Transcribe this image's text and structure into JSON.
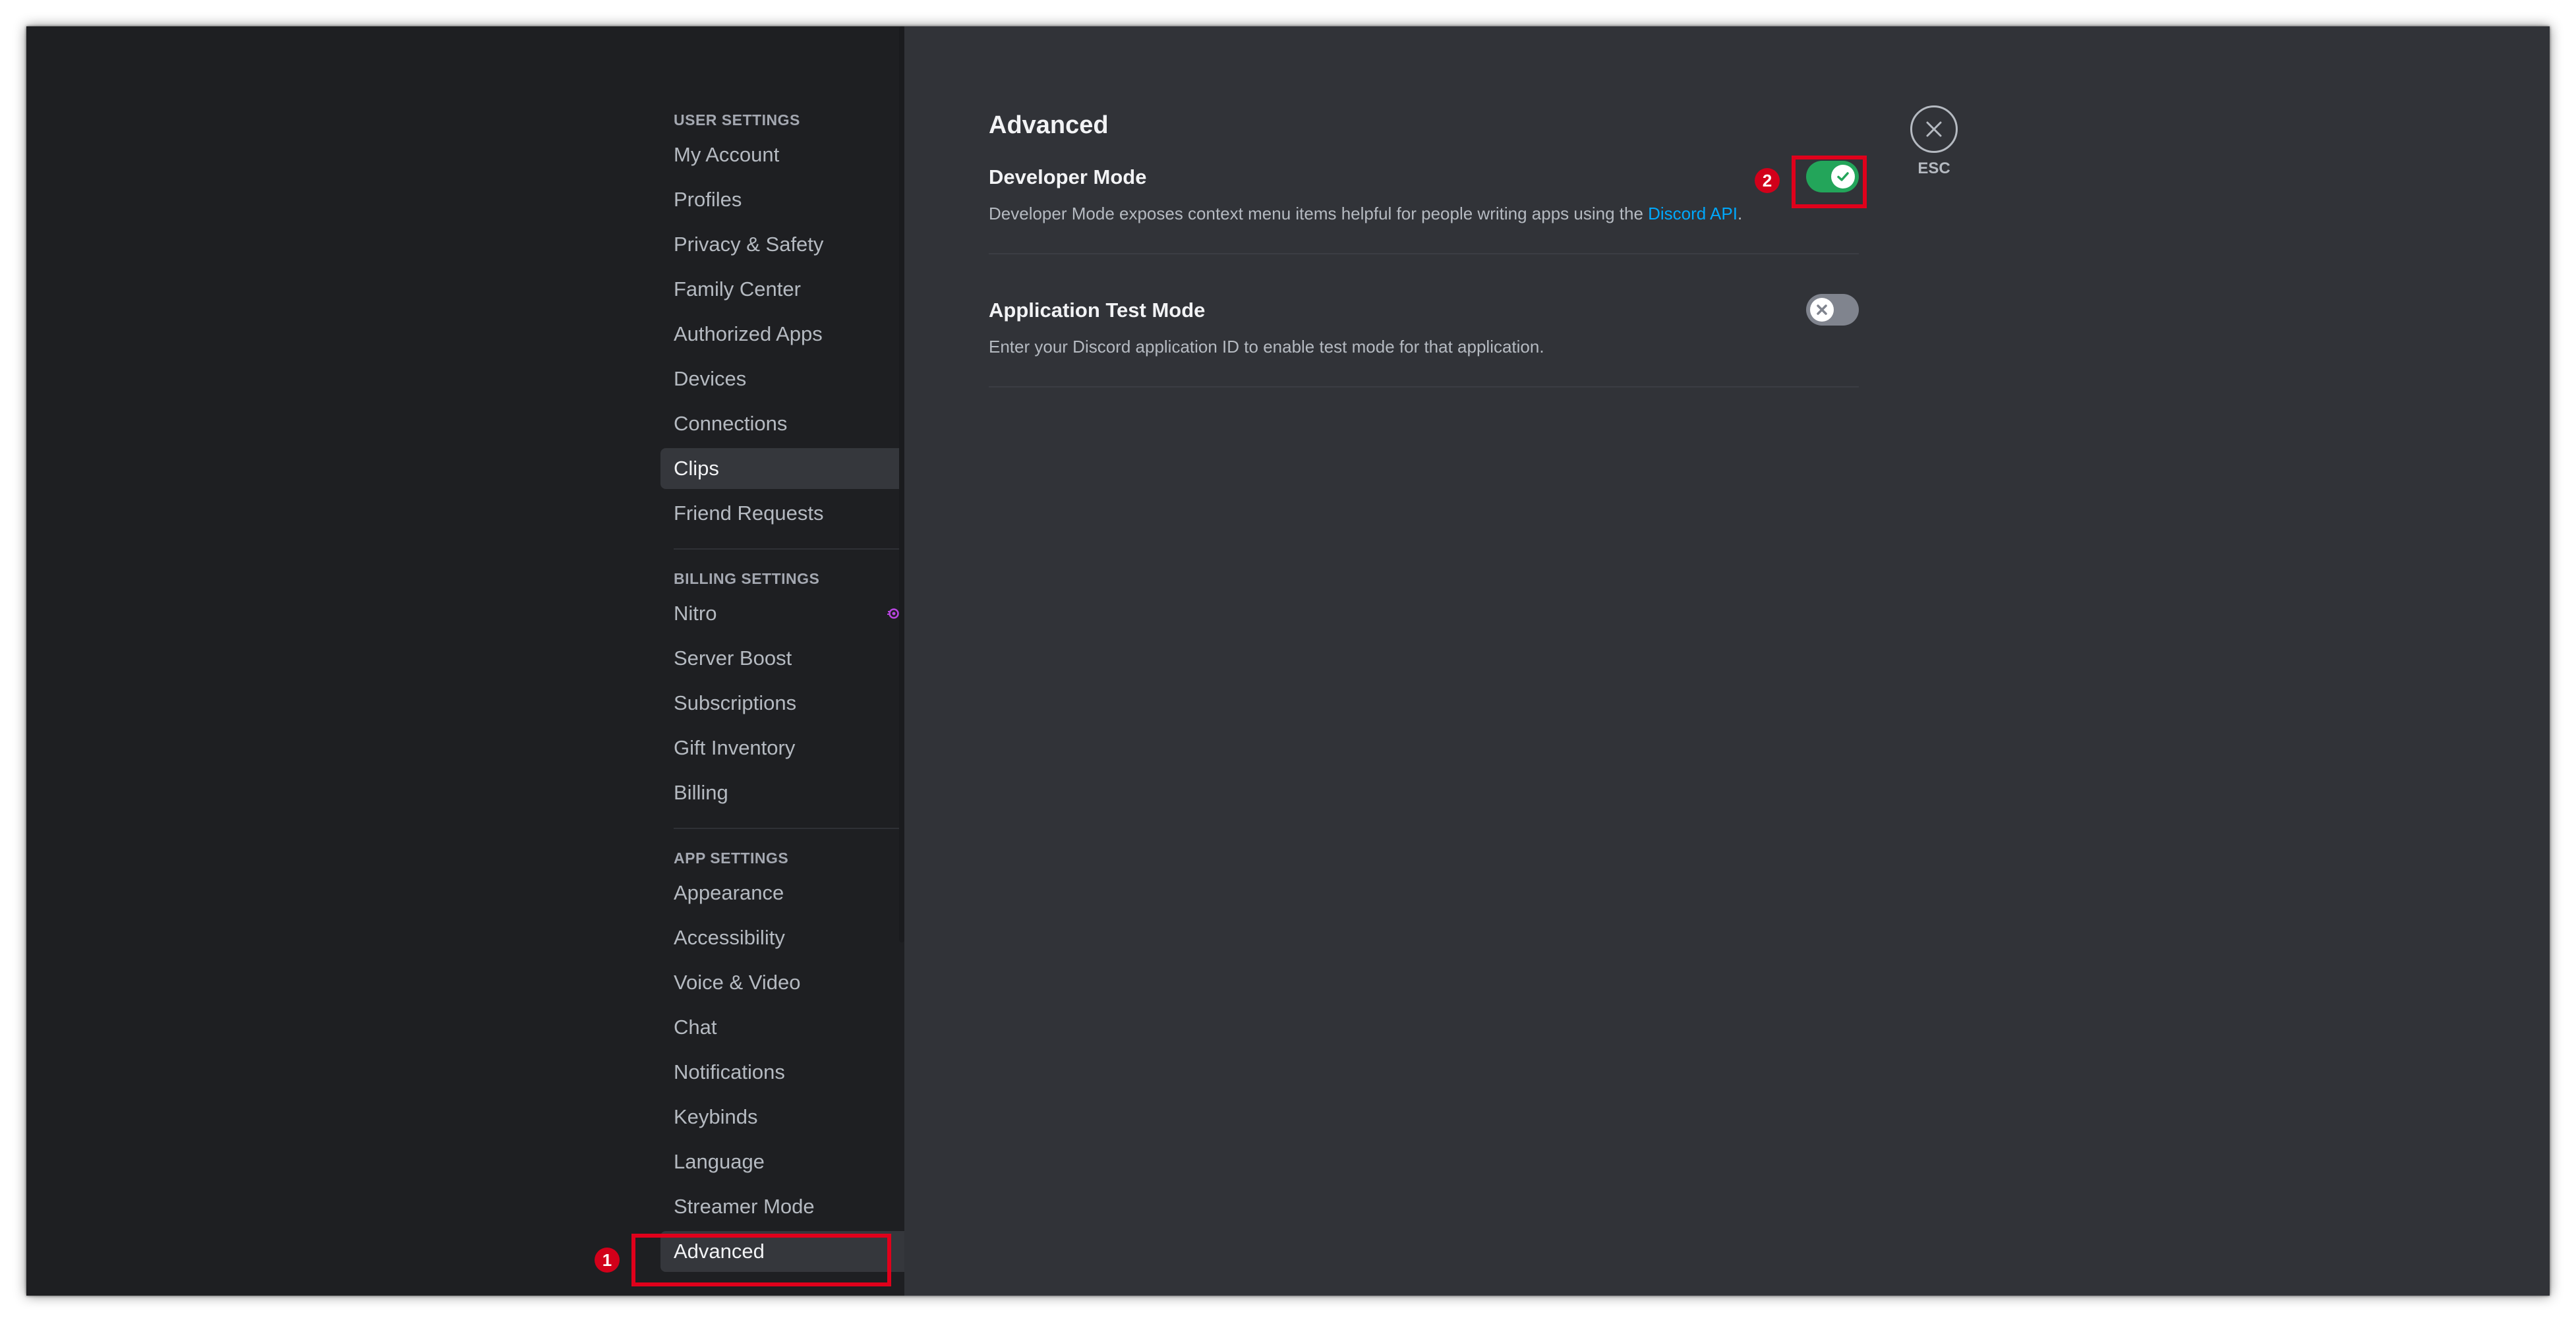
{
  "sidebar": {
    "user_settings_header": "USER SETTINGS",
    "user_items": [
      {
        "label": "My Account"
      },
      {
        "label": "Profiles"
      },
      {
        "label": "Privacy & Safety"
      },
      {
        "label": "Family Center"
      },
      {
        "label": "Authorized Apps"
      },
      {
        "label": "Devices"
      },
      {
        "label": "Connections"
      },
      {
        "label": "Clips"
      },
      {
        "label": "Friend Requests"
      }
    ],
    "billing_settings_header": "BILLING SETTINGS",
    "billing_items": [
      {
        "label": "Nitro",
        "badge_icon": "nitro-boost-icon"
      },
      {
        "label": "Server Boost"
      },
      {
        "label": "Subscriptions"
      },
      {
        "label": "Gift Inventory"
      },
      {
        "label": "Billing"
      }
    ],
    "app_settings_header": "APP SETTINGS",
    "app_items": [
      {
        "label": "Appearance"
      },
      {
        "label": "Accessibility"
      },
      {
        "label": "Voice & Video"
      },
      {
        "label": "Chat"
      },
      {
        "label": "Notifications"
      },
      {
        "label": "Keybinds"
      },
      {
        "label": "Language"
      },
      {
        "label": "Streamer Mode"
      },
      {
        "label": "Advanced"
      }
    ],
    "hovered_item": "Clips",
    "selected_item": "Advanced"
  },
  "main": {
    "title": "Advanced",
    "settings": [
      {
        "title": "Developer Mode",
        "description_prefix": "Developer Mode exposes context menu items helpful for people writing apps using the ",
        "link_text": "Discord API",
        "description_suffix": ".",
        "enabled": true
      },
      {
        "title": "Application Test Mode",
        "description": "Enter your Discord application ID to enable test mode for that application.",
        "enabled": false
      }
    ]
  },
  "close": {
    "label": "ESC",
    "icon": "close-icon"
  },
  "annotations": [
    {
      "number": "1",
      "target": "Advanced"
    },
    {
      "number": "2",
      "target": "Developer Mode toggle"
    }
  ],
  "colors": {
    "sidebar_bg": "#1e1f22",
    "content_bg": "#313338",
    "toggle_on": "#23a55a",
    "toggle_off": "#80848e",
    "link": "#00a8fc",
    "annotation_red": "#e0001b",
    "nitro_badge": "#b845e0"
  }
}
